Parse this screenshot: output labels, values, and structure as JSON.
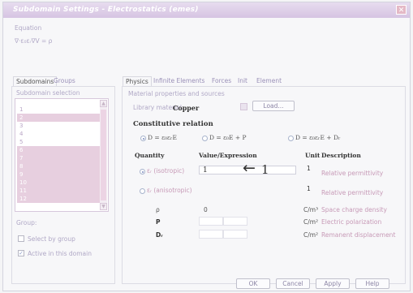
{
  "window": {
    "title": "Subdomain Settings - Electrostatics (emes)"
  },
  "equation": {
    "label": "Equation",
    "text": "∇·ε₀εᵣ∇V = ρ"
  },
  "left": {
    "tabs": [
      "Subdomains",
      "Groups"
    ],
    "selection_label": "Subdomain selection",
    "items": [
      "1",
      "2",
      "3",
      "4",
      "5",
      "6",
      "7",
      "8",
      "9",
      "10",
      "11",
      "12"
    ],
    "group_label": "Group:",
    "select_by_group": "Select by group",
    "active_in_domain": "Active in this domain"
  },
  "tabs": [
    "Physics",
    "Infinite Elements",
    "Forces",
    "Init",
    "Element"
  ],
  "material": {
    "group_label": "Material properties and sources",
    "library_label": "Library material:",
    "library_value": "Copper",
    "load_button": "Load..."
  },
  "constitutive": {
    "title": "Constitutive relation",
    "options": [
      "D = ε₀εᵣE",
      "D = ε₀E + P",
      "D = ε₀εᵣE + Dᵣ"
    ]
  },
  "table": {
    "headers": [
      "Quantity",
      "Value/Expression",
      "Unit",
      "Description"
    ],
    "rows": [
      {
        "quantity": "εᵣ (isotropic)",
        "value": "1",
        "unit": "1",
        "desc": "Relative permittivity"
      },
      {
        "quantity": "εᵣ (anisotropic)",
        "value": "",
        "unit": "1",
        "desc": "Relative permittivity"
      },
      {
        "quantity": "ρ",
        "value": "0",
        "unit": "C/m³",
        "desc": "Space charge density"
      },
      {
        "quantity": "P",
        "value": "",
        "unit": "C/m²",
        "desc": "Electric polarization"
      },
      {
        "quantity": "Dᵣ",
        "value": "",
        "unit": "C/m²",
        "desc": "Remanent displacement"
      }
    ]
  },
  "annotation": {
    "arrow": "←",
    "number": "1"
  },
  "buttons": {
    "ok": "OK",
    "cancel": "Cancel",
    "apply": "Apply",
    "help": "Help"
  },
  "colors": {
    "title_bar": "#d6c4e2",
    "selection": "#e7cfdf"
  }
}
